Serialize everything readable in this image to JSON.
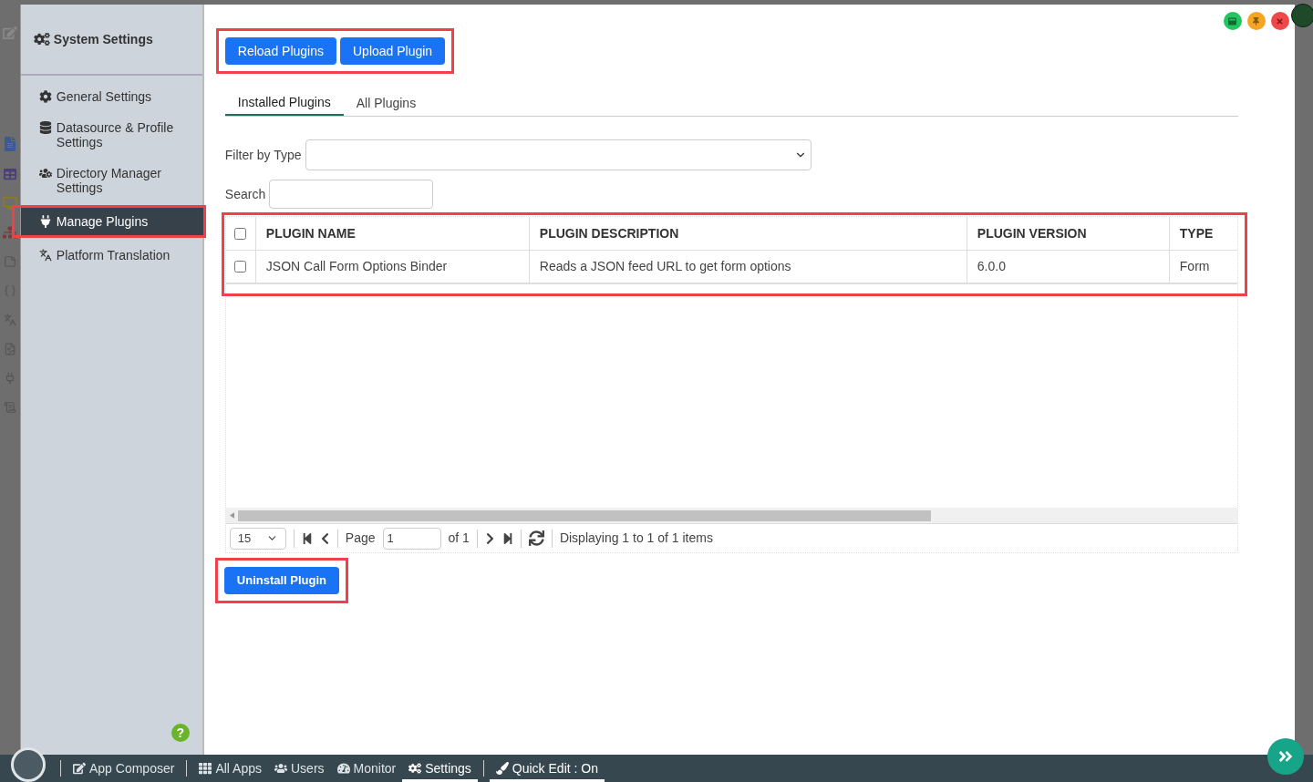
{
  "sidebar": {
    "title": "System Settings",
    "items": [
      {
        "label": "General Settings",
        "selected": false
      },
      {
        "label": "Datasource & Profile Settings",
        "selected": false
      },
      {
        "label": "Directory Manager Settings",
        "selected": false
      },
      {
        "label": "Manage Plugins",
        "selected": true
      },
      {
        "label": "Platform Translation",
        "selected": false
      }
    ],
    "help": "?"
  },
  "toolbar": {
    "buttons": [
      "Reload Plugins",
      "Upload Plugin"
    ]
  },
  "tabs": [
    {
      "label": "Installed Plugins",
      "selected": true
    },
    {
      "label": "All Plugins",
      "selected": false
    }
  ],
  "filter": {
    "label": "Filter by Type"
  },
  "search": {
    "label": "Search"
  },
  "table": {
    "header_checked": false,
    "columns": [
      "PLUGIN NAME",
      "PLUGIN DESCRIPTION",
      "PLUGIN VERSION",
      "TYPE"
    ],
    "rows": [
      {
        "checked": false,
        "cells": [
          "JSON Call Form Options Binder",
          "Reads a JSON feed URL to get form options",
          "6.0.0",
          "Form"
        ]
      }
    ]
  },
  "pager": {
    "page_size": "15",
    "page_label": "Page",
    "page": "1",
    "of": "of 1",
    "status": "Displaying 1 to 1 of 1 items"
  },
  "uninstall_button": "Uninstall Plugin",
  "taskbar": {
    "items": [
      {
        "label": "App Composer",
        "selected": false
      },
      {
        "label": "All Apps",
        "selected": false
      },
      {
        "label": "Users",
        "selected": false
      },
      {
        "label": "Monitor",
        "selected": false
      },
      {
        "label": "Settings",
        "selected": true
      },
      {
        "label": "Quick Edit : On",
        "selected": true
      }
    ]
  }
}
